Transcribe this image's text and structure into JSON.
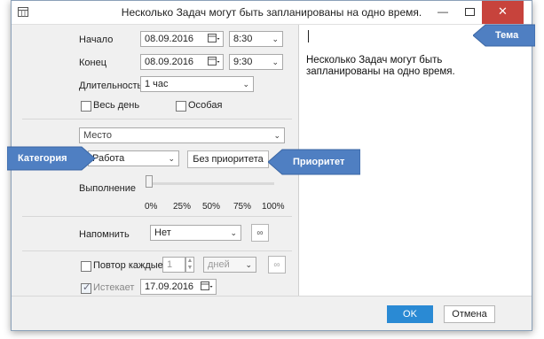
{
  "window": {
    "title": "Несколько Задач могут быть запланированы на одно время."
  },
  "schedule": {
    "start_label": "Начало",
    "start_date": "08.09.2016",
    "start_time": "8:30",
    "end_label": "Конец",
    "end_date": "08.09.2016",
    "end_time": "9:30",
    "duration_label": "Длительность",
    "duration_value": "1 час",
    "allday_label": "Весь день",
    "special_label": "Особая"
  },
  "details": {
    "place_placeholder": "Место",
    "category_value": "Работа",
    "priority_label": "Без приоритета",
    "progress_label": "Выполнение",
    "progress_value": 0,
    "progress_ticks": [
      "0%",
      "25%",
      "50%",
      "75%",
      "100%"
    ]
  },
  "reminder": {
    "label": "Напомнить",
    "value": "Нет"
  },
  "repeat": {
    "repeat_label": "Повтор каждые",
    "repeat_count": "1",
    "repeat_unit": "дней",
    "expires_label": "Истекает",
    "expires_date": "17.09.2016"
  },
  "notes": {
    "text": "Несколько Задач могут быть запланированы на одно время."
  },
  "buttons": {
    "ok": "OK",
    "cancel": "Отмена"
  },
  "callouts": {
    "theme": "Тема",
    "category": "Категория",
    "priority": "Приоритет"
  },
  "colors": {
    "accent": "#2a8ad4",
    "callout": "#4f7fc2",
    "close": "#c7433c"
  }
}
